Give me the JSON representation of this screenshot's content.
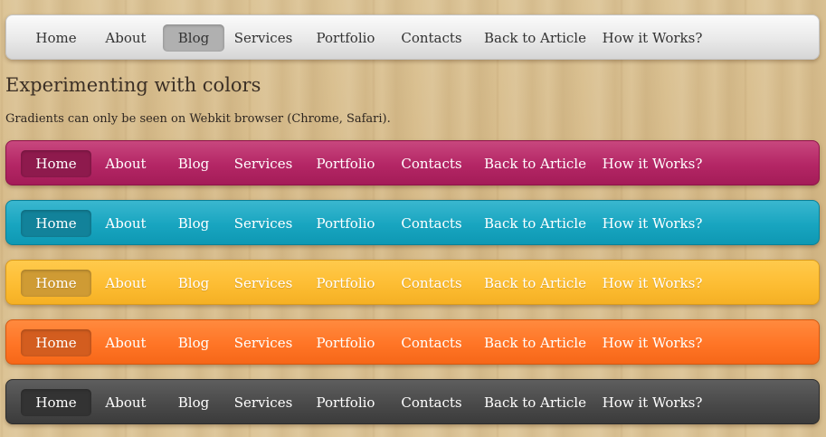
{
  "menu_items": [
    "Home",
    "About",
    "Blog",
    "Services",
    "Portfolio",
    "Contacts",
    "Back to Article",
    "How it Works?"
  ],
  "heading": "Experimenting with colors",
  "subtext": "Gradients can only be seen on Webkit browser (Chrome, Safari).",
  "navbars": [
    {
      "id": "gray",
      "color": "#e6e6e6",
      "active_index": 2
    },
    {
      "id": "pink",
      "color": "#b42665",
      "active_index": 0
    },
    {
      "id": "teal",
      "color": "#18a5c0",
      "active_index": 0
    },
    {
      "id": "yellow",
      "color": "#fdbd33",
      "active_index": 0
    },
    {
      "id": "orange",
      "color": "#ff7526",
      "active_index": 0
    },
    {
      "id": "dark",
      "color": "#4a4a4a",
      "active_index": 0
    }
  ]
}
